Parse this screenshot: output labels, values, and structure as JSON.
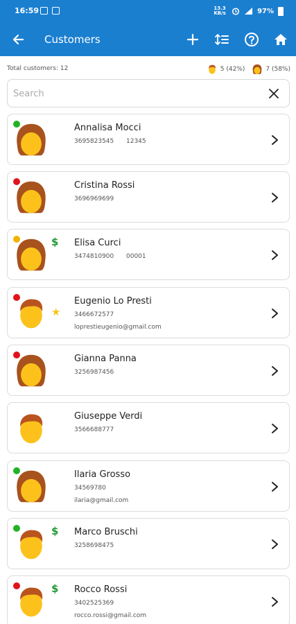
{
  "status_bar": {
    "time": "16:59",
    "signal_label": "13.3 KB/s",
    "battery": "97%"
  },
  "appbar": {
    "title": "Customers",
    "icons": [
      "back-arrow-icon",
      "add-icon",
      "sort-icon",
      "help-icon",
      "home-icon"
    ]
  },
  "summary": {
    "total_label": "Total customers: 12",
    "male_count": "5 (42%)",
    "female_count": "7 (58%)"
  },
  "search": {
    "placeholder": "Search",
    "value": ""
  },
  "colors": {
    "brand": "#1b7fd0",
    "status_green": "#22b324",
    "status_red": "#e0141a",
    "status_yellow": "#f2b300",
    "dollar_green": "#1f9a33",
    "star_gold": "#f5c518"
  },
  "customers": [
    {
      "name": "Annalisa Mocci",
      "phone": "3695823545",
      "code": "12345",
      "email": "",
      "gender": "female",
      "status": "green",
      "badge": ""
    },
    {
      "name": "Cristina Rossi",
      "phone": "3696969699",
      "code": "",
      "email": "",
      "gender": "female",
      "status": "red",
      "badge": ""
    },
    {
      "name": "Elisa Curci",
      "phone": "3474810900",
      "code": "00001",
      "email": "",
      "gender": "female",
      "status": "yellow",
      "badge": "$"
    },
    {
      "name": "Eugenio Lo Presti",
      "phone": "3466672577",
      "code": "",
      "email": "loprestieugenio@gmail.com",
      "gender": "male",
      "status": "red",
      "badge": "★"
    },
    {
      "name": "Gianna Panna",
      "phone": "3256987456",
      "code": "",
      "email": "",
      "gender": "female",
      "status": "red",
      "badge": ""
    },
    {
      "name": "Giuseppe Verdi",
      "phone": "3566688777",
      "code": "",
      "email": "",
      "gender": "male",
      "status": "",
      "badge": ""
    },
    {
      "name": "Ilaria Grosso",
      "phone": "34569780",
      "code": "",
      "email": "ilaria@gmail.com",
      "gender": "female",
      "status": "green",
      "badge": ""
    },
    {
      "name": "Marco Bruschi",
      "phone": "3258698475",
      "code": "",
      "email": "",
      "gender": "male",
      "status": "green",
      "badge": "$"
    },
    {
      "name": "Rocco Rossi",
      "phone": "3402525369",
      "code": "",
      "email": "rocco.rossi@gmail.com",
      "gender": "male",
      "status": "red",
      "badge": "$"
    }
  ]
}
